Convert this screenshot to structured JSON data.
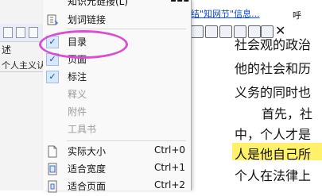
{
  "left_panel": {
    "tab_label": "述",
    "outline_text": "个人主义认"
  },
  "document": {
    "link_text": "结\"知网节\"信息...",
    "link_tail": "呼"
  },
  "menu": {
    "top_partial_label": "知识元链接(L)",
    "items": [
      {
        "label": "划词链接",
        "shortcut": "",
        "checked": false,
        "disabled": false,
        "icon": "word-link-icon"
      },
      {
        "label": "目录",
        "shortcut": "",
        "checked": true,
        "disabled": false,
        "icon": "check-icon"
      },
      {
        "label": "页面",
        "shortcut": "",
        "checked": true,
        "disabled": false,
        "icon": "check-icon"
      },
      {
        "label": "标注",
        "shortcut": "",
        "checked": true,
        "disabled": false,
        "icon": "check-icon"
      },
      {
        "label": "释义",
        "shortcut": "",
        "checked": false,
        "disabled": true,
        "icon": ""
      },
      {
        "label": "附件",
        "shortcut": "",
        "checked": false,
        "disabled": true,
        "icon": ""
      },
      {
        "label": "工具书",
        "shortcut": "",
        "checked": false,
        "disabled": true,
        "icon": ""
      },
      {
        "label": "实际大小",
        "shortcut": "Ctrl+0",
        "checked": false,
        "disabled": false,
        "icon": "page-actual-size-icon"
      },
      {
        "label": "适合宽度",
        "shortcut": "Ctrl+1",
        "checked": false,
        "disabled": false,
        "icon": "page-fit-width-icon"
      },
      {
        "label": "适合页面",
        "shortcut": "Ctrl+2",
        "checked": false,
        "disabled": false,
        "icon": "page-fit-page-icon"
      }
    ]
  },
  "highlight": {
    "color": "#d84fd6",
    "shape": "ellipse-around-目录"
  },
  "doc_lines": [
    "社会观的政治",
    "他的社会和历",
    "义务的同时也",
    "首先，社",
    "中，个人才是",
    "人是他自己所",
    "个人在法律上"
  ]
}
